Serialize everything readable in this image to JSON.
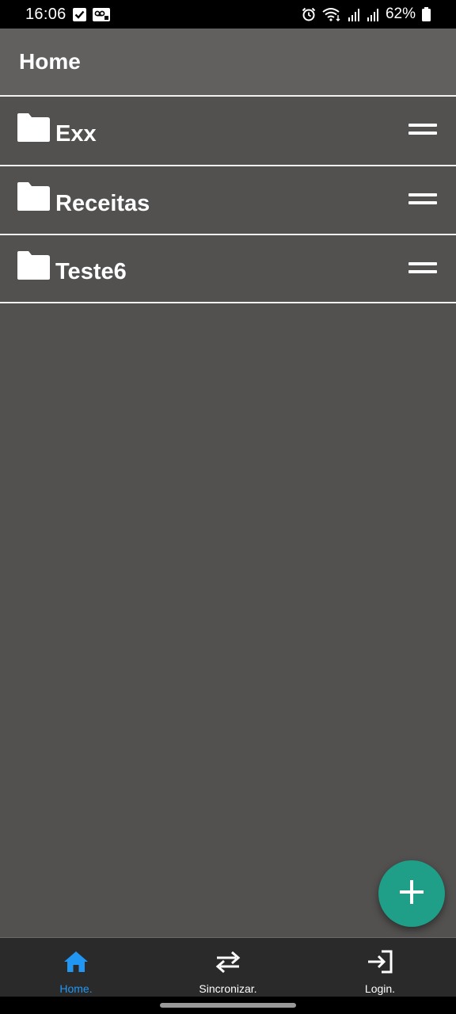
{
  "status_bar": {
    "time": "16:06",
    "battery": "62%",
    "icons": [
      "checkbox-notification-icon",
      "voicemail-icon",
      "alarm-icon",
      "wifi-icon",
      "signal-icon",
      "signal-icon",
      "battery-icon"
    ]
  },
  "app_bar": {
    "title": "Home"
  },
  "folders": [
    {
      "name": "Exx",
      "icon": "folder-icon"
    },
    {
      "name": "Receitas",
      "icon": "folder-icon"
    },
    {
      "name": "Teste6",
      "icon": "folder-icon"
    }
  ],
  "fab": {
    "icon": "plus-icon",
    "color": "#1f9e88"
  },
  "bottom_nav": {
    "items": [
      {
        "label": "Home.",
        "icon": "home-icon",
        "active": true
      },
      {
        "label": "Sincronizar.",
        "icon": "sync-icon",
        "active": false
      },
      {
        "label": "Login.",
        "icon": "login-icon",
        "active": false
      }
    ],
    "active_color": "#2196f3"
  },
  "colors": {
    "background": "#525150",
    "app_bar": "#61605f",
    "nav_bar": "#2b2a2a"
  }
}
